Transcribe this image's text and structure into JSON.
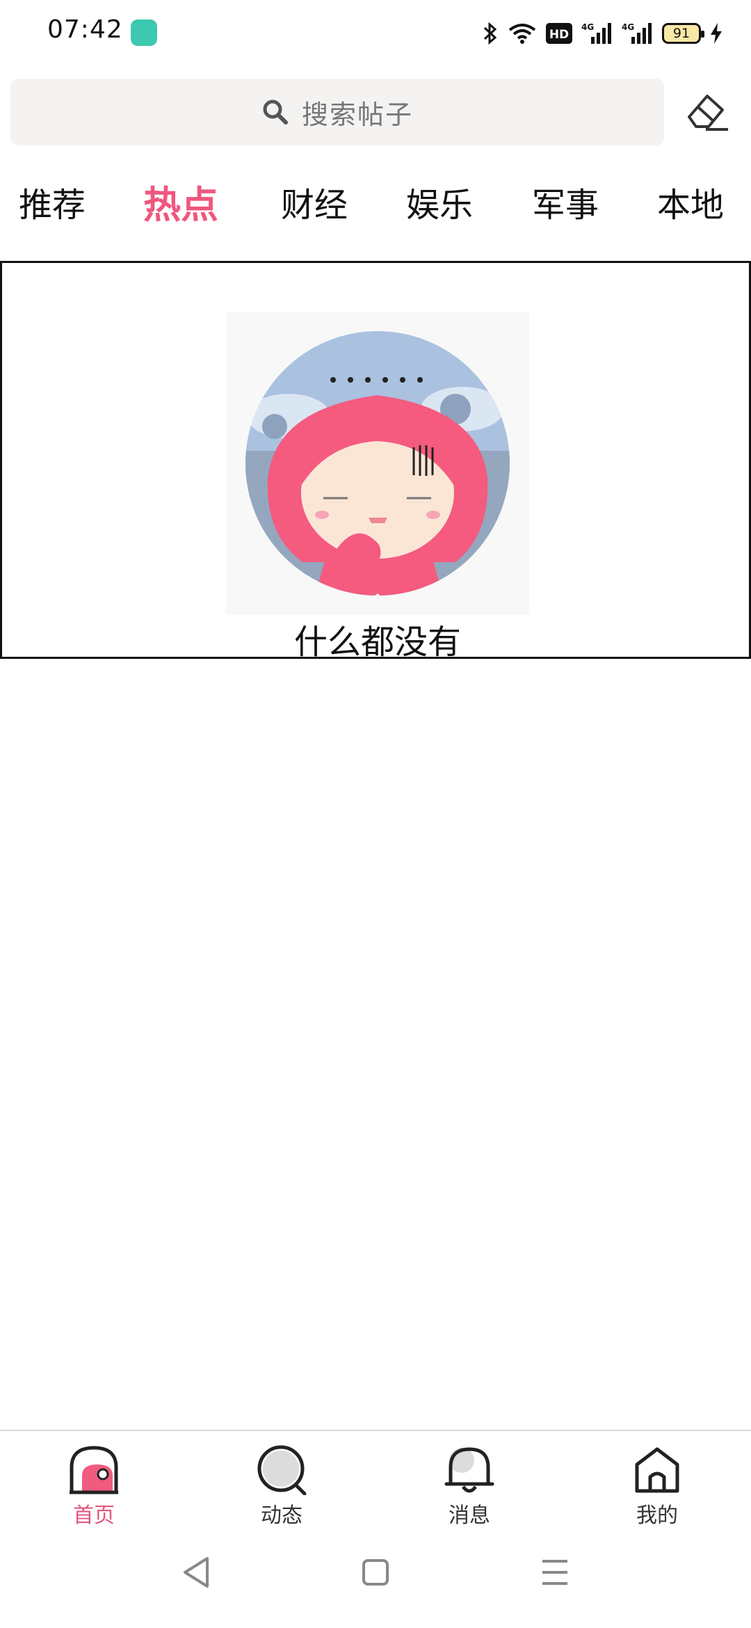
{
  "status_bar": {
    "time": "07:42",
    "battery_level": "91",
    "network_badge": "HD",
    "signal_1": "4G",
    "signal_2": "4G",
    "icons": [
      "bluetooth-icon",
      "wifi-icon",
      "hd-icon",
      "signal-4g-icon",
      "signal-4g-icon",
      "battery-icon",
      "charging-icon"
    ]
  },
  "search": {
    "placeholder": "搜索帖子"
  },
  "header": {
    "edit_icon": "edit-icon"
  },
  "tabs": [
    {
      "label": "推荐",
      "active": false
    },
    {
      "label": "热点",
      "active": true
    },
    {
      "label": "财经",
      "active": false
    },
    {
      "label": "娱乐",
      "active": false
    },
    {
      "label": "军事",
      "active": false
    },
    {
      "label": "本地",
      "active": false
    }
  ],
  "empty_state": {
    "message": "什么都没有"
  },
  "bottom_nav": [
    {
      "label": "首页",
      "icon": "home-dome-icon",
      "active": true
    },
    {
      "label": "动态",
      "icon": "search-lens-icon",
      "active": false
    },
    {
      "label": "消息",
      "icon": "bell-icon",
      "active": false
    },
    {
      "label": "我的",
      "icon": "house-icon",
      "active": false
    }
  ],
  "colors": {
    "accent": "#ef577d",
    "search_bg": "#f4f3f1",
    "text": "#111111"
  }
}
